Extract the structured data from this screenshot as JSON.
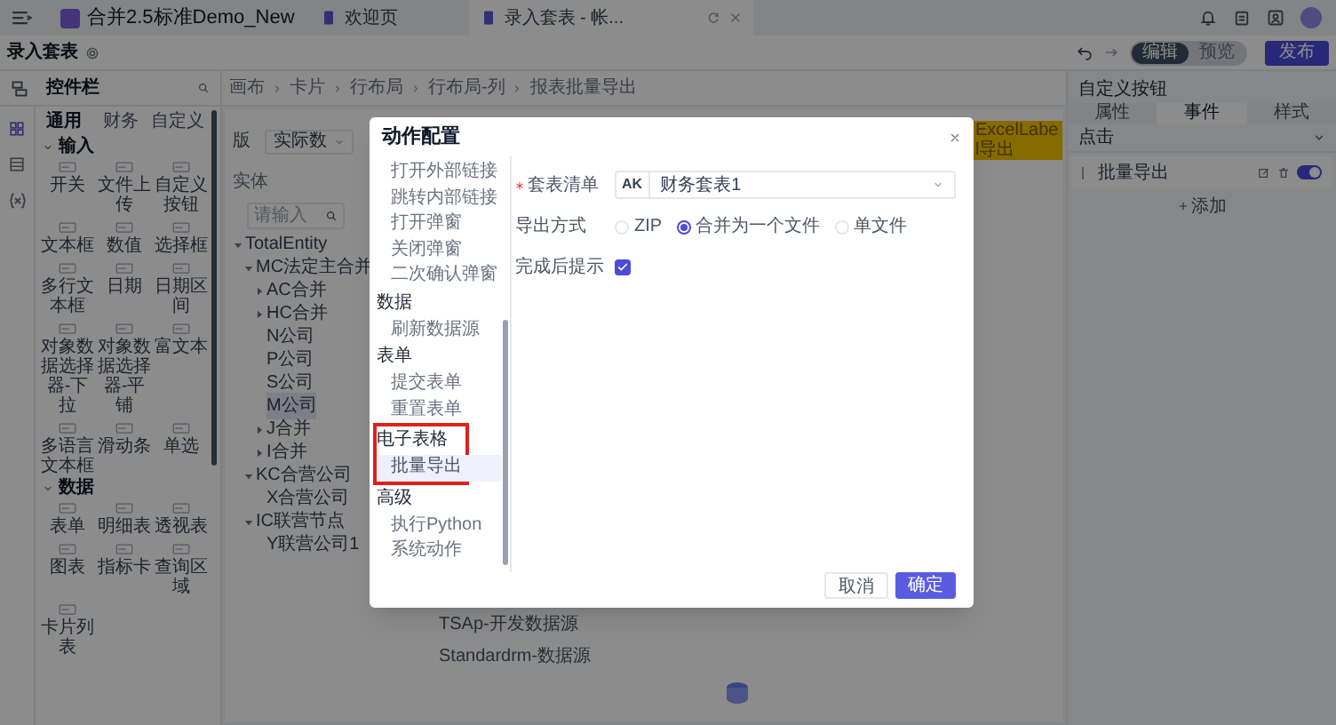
{
  "top_bar": {
    "tabs": [
      {
        "label": "合并2.5标准Demo_New",
        "kind": "app",
        "selected": false
      },
      {
        "label": "欢迎页",
        "kind": "page",
        "selected": false
      },
      {
        "label": "录入套表 - 帐...",
        "kind": "page",
        "selected": true
      }
    ]
  },
  "page_header": {
    "title": "录入套表",
    "mode_toggle": [
      {
        "label": "编辑",
        "selected": true
      },
      {
        "label": "预览",
        "selected": false
      }
    ],
    "publish_button": "发布"
  },
  "control_panel": {
    "title": "控件栏",
    "tabs": [
      {
        "label": "通用",
        "selected": true
      },
      {
        "label": "财务",
        "selected": false
      },
      {
        "label": "自定义",
        "selected": false
      }
    ],
    "sections": [
      {
        "title": "输入",
        "expanded": true,
        "items": [
          "开关",
          "文件上传",
          "自定义按钮",
          "文本框",
          "数值",
          "选择框",
          "多行文本框",
          "日期",
          "日期区间",
          "对象数据选择器-下拉",
          "对象数据选择器-平铺",
          "富文本",
          "多语言文本框",
          "滑动条",
          "单选"
        ]
      },
      {
        "title": "数据",
        "expanded": true,
        "items": [
          "表单",
          "明细表",
          "透视表",
          "图表",
          "指标卡",
          "查询区域",
          "卡片列表"
        ]
      }
    ]
  },
  "breadcrumb": [
    "画布",
    "卡片",
    "行布局",
    "行布局-列",
    "报表批量导出"
  ],
  "canvas": {
    "filter_label": "版",
    "filter_value": "实际数",
    "entity_label": "实体",
    "search_placeholder": "请输入",
    "export_button": "ExcelLabel导出",
    "tree": [
      {
        "label": "TotalEntity",
        "expanded": true,
        "selected": false,
        "children": [
          {
            "label": "MC法定主合并",
            "expanded": true,
            "selected": false,
            "children": [
              {
                "label": "AC合并",
                "expanded": false,
                "selected": false
              },
              {
                "label": "HC合并",
                "expanded": false,
                "selected": false
              },
              {
                "label": "N公司",
                "selected": false
              },
              {
                "label": "P公司",
                "selected": false
              },
              {
                "label": "S公司",
                "selected": false
              },
              {
                "label": "M公司",
                "selected": true
              },
              {
                "label": "J合并",
                "expanded": false,
                "selected": false
              },
              {
                "label": "I合并",
                "expanded": false,
                "selected": false
              }
            ]
          },
          {
            "label": "KC合营公司",
            "expanded": true,
            "selected": false,
            "children": [
              {
                "label": "X合营公司",
                "selected": false
              }
            ]
          },
          {
            "label": "IC联营节点",
            "expanded": true,
            "selected": false,
            "children": [
              {
                "label": "Y联营公司1",
                "selected": false
              }
            ]
          }
        ]
      }
    ],
    "bottom_rows": [
      "TSAp-开发数据源",
      "Standardrm-数据源"
    ]
  },
  "right_panel": {
    "title": "自定义按钮",
    "tabs": [
      {
        "label": "属性",
        "selected": false
      },
      {
        "label": "事件",
        "selected": true
      },
      {
        "label": "样式",
        "selected": false
      }
    ],
    "event": "点击",
    "actions": [
      {
        "label": "批量导出",
        "on": true
      }
    ],
    "add_label": "添加"
  },
  "dialog": {
    "title": "动作配置",
    "nav": [
      {
        "items": [
          {
            "label": "打开外部链接",
            "selected": false
          },
          {
            "label": "跳转内部链接",
            "selected": false
          },
          {
            "label": "打开弹窗",
            "selected": false
          },
          {
            "label": "关闭弹窗",
            "selected": false
          },
          {
            "label": "二次确认弹窗",
            "selected": false
          }
        ]
      },
      {
        "title": "数据",
        "highlighted": false,
        "items": [
          {
            "label": "刷新数据源",
            "selected": false
          }
        ]
      },
      {
        "title": "表单",
        "highlighted": false,
        "items": [
          {
            "label": "提交表单",
            "selected": false
          },
          {
            "label": "重置表单",
            "selected": false
          }
        ]
      },
      {
        "title": "电子表格",
        "highlighted": true,
        "items": [
          {
            "label": "批量导出",
            "selected": true
          }
        ]
      },
      {
        "title": "高级",
        "highlighted": false,
        "items": [
          {
            "label": "执行Python",
            "selected": false
          },
          {
            "label": "系统动作",
            "selected": false
          }
        ]
      }
    ],
    "fields": [
      {
        "kind": "select",
        "label": "套表清单",
        "required": true,
        "prefix": "AK",
        "value": "财务套表1"
      },
      {
        "kind": "radio",
        "label": "导出方式",
        "required": false,
        "options": [
          {
            "label": "ZIP",
            "selected": false
          },
          {
            "label": "合并为一个文件",
            "selected": true
          },
          {
            "label": "单文件",
            "selected": false
          }
        ]
      },
      {
        "kind": "checkbox",
        "label": "完成后提示",
        "required": false,
        "checked": true
      }
    ],
    "buttons": [
      {
        "label": "取消",
        "kind": "secondary"
      },
      {
        "label": "确定",
        "kind": "primary"
      }
    ]
  }
}
